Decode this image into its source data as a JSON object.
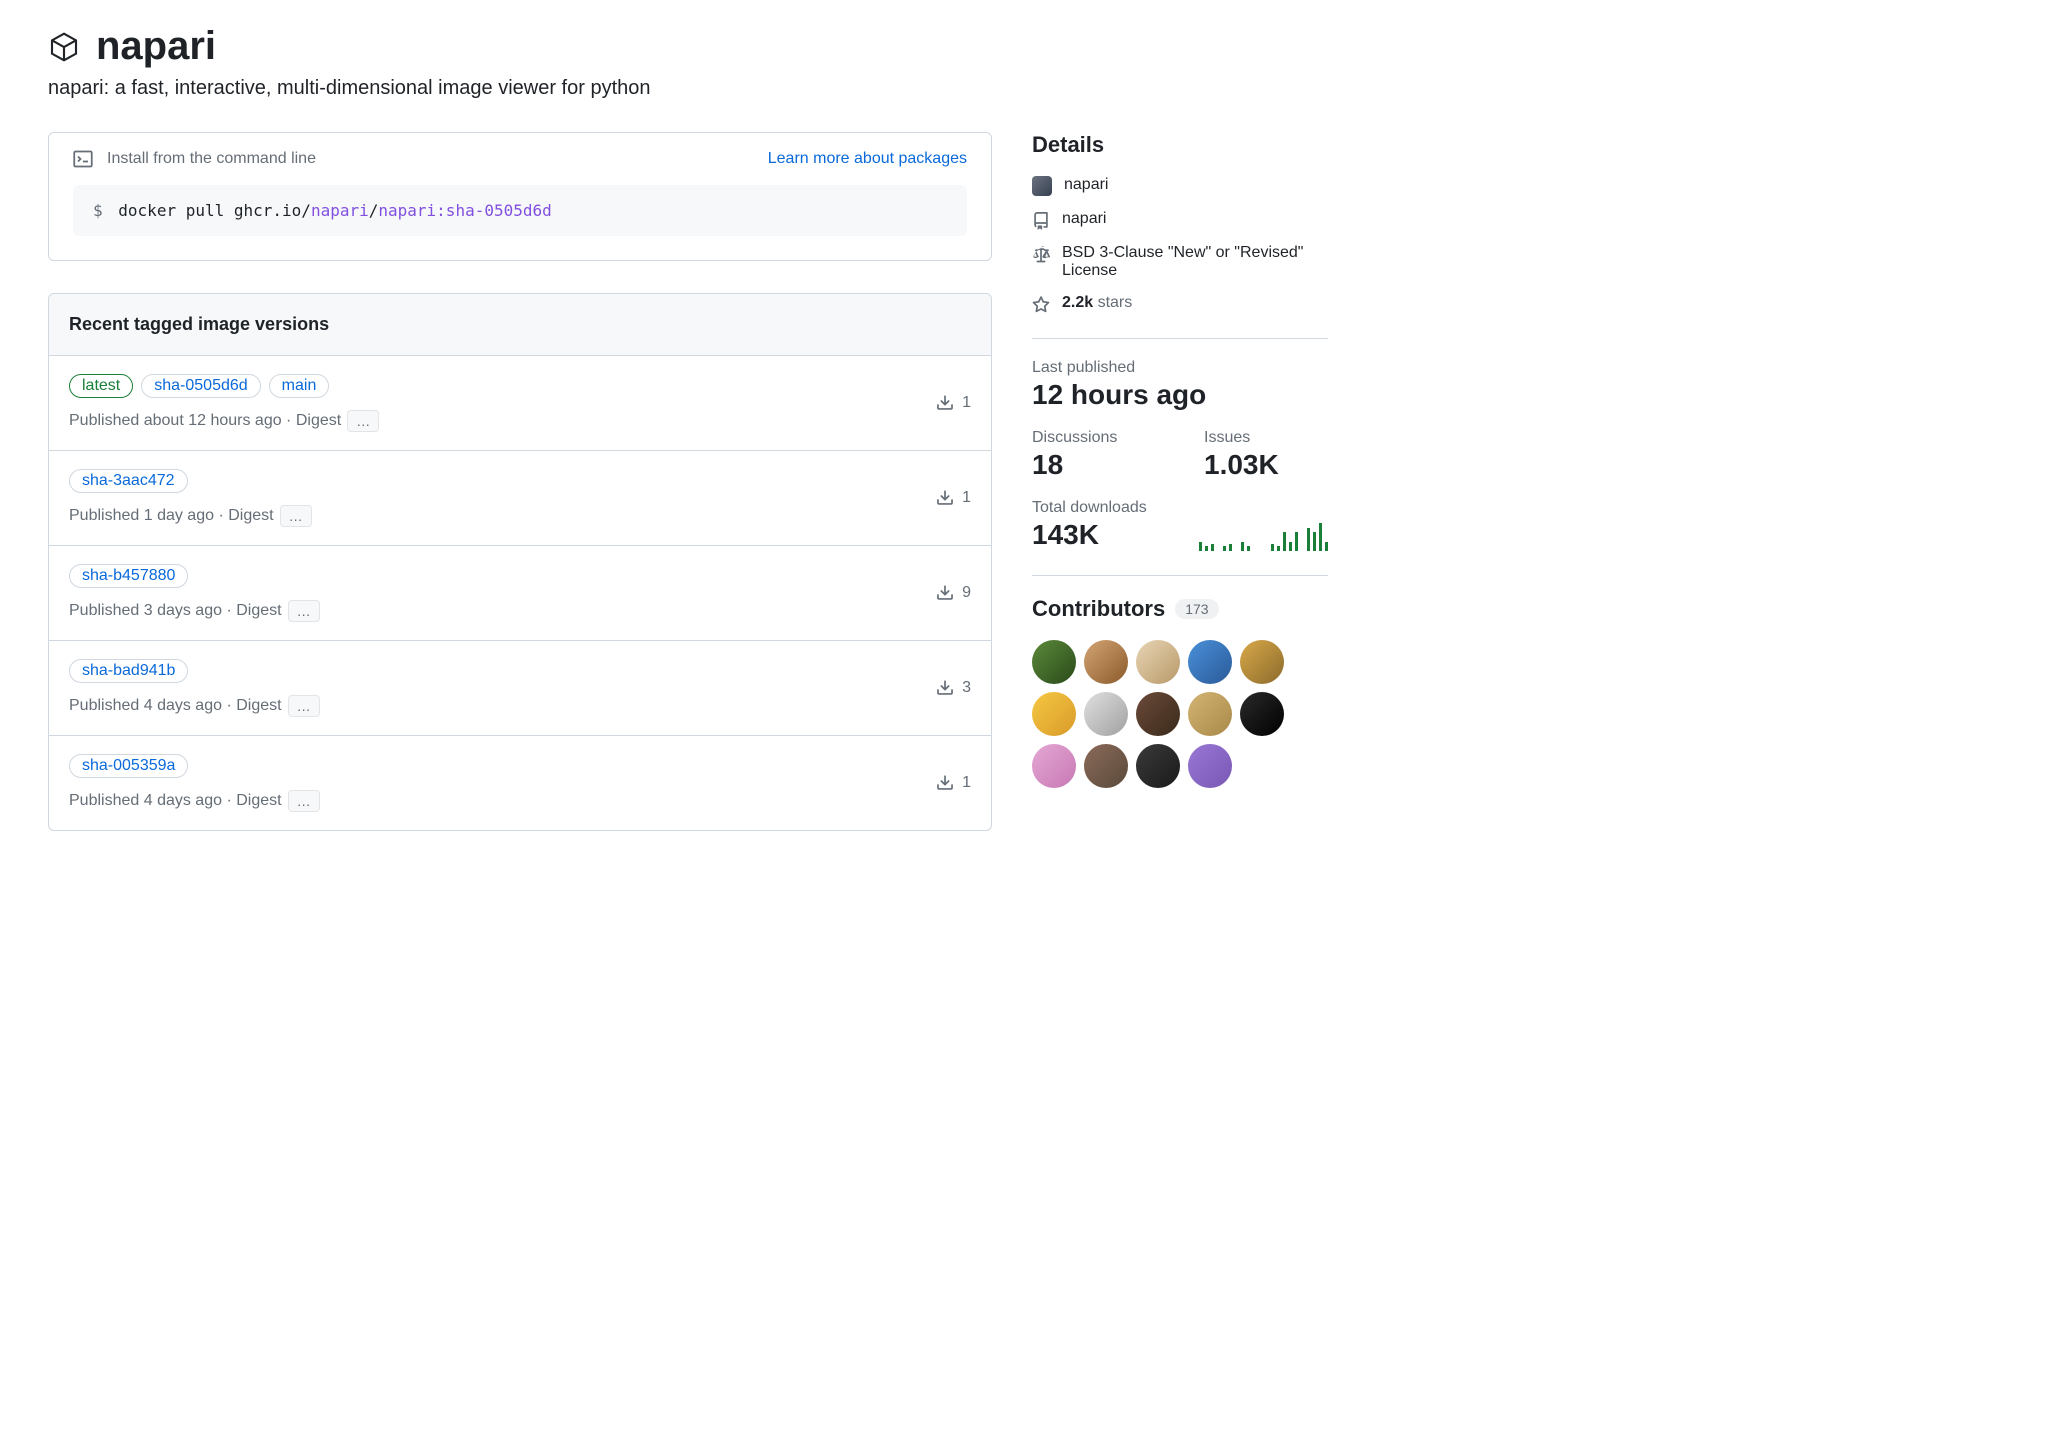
{
  "package": {
    "name": "napari",
    "description": "napari: a fast, interactive, multi-dimensional image viewer for python"
  },
  "install": {
    "label": "Install from the command line",
    "learn_link": "Learn more about packages",
    "prompt": "$",
    "cmd_prefix": "docker pull ghcr.io/",
    "cmd_org": "napari",
    "cmd_sep": "/",
    "cmd_ref": "napari:sha-0505d6d"
  },
  "versions": {
    "title": "Recent tagged image versions",
    "rows": [
      {
        "tags": [
          {
            "label": "latest",
            "variant": "latest"
          },
          {
            "label": "sha-0505d6d",
            "variant": ""
          },
          {
            "label": "main",
            "variant": ""
          }
        ],
        "meta": "Published about 12 hours ago · Digest",
        "downloads": "1"
      },
      {
        "tags": [
          {
            "label": "sha-3aac472",
            "variant": ""
          }
        ],
        "meta": "Published 1 day ago · Digest",
        "downloads": "1"
      },
      {
        "tags": [
          {
            "label": "sha-b457880",
            "variant": ""
          }
        ],
        "meta": "Published 3 days ago · Digest",
        "downloads": "9"
      },
      {
        "tags": [
          {
            "label": "sha-bad941b",
            "variant": ""
          }
        ],
        "meta": "Published 4 days ago · Digest",
        "downloads": "3"
      },
      {
        "tags": [
          {
            "label": "sha-005359a",
            "variant": ""
          }
        ],
        "meta": "Published 4 days ago · Digest",
        "downloads": "1"
      }
    ]
  },
  "details": {
    "title": "Details",
    "owner": "napari",
    "repo": "napari",
    "license": "BSD 3-Clause \"New\" or \"Revised\" License",
    "stars_count": "2.2k",
    "stars_suffix": " stars"
  },
  "stats": {
    "last_published_label": "Last published",
    "last_published_value": "12 hours ago",
    "discussions_label": "Discussions",
    "discussions_value": "18",
    "issues_label": "Issues",
    "issues_value": "1.03K",
    "downloads_label": "Total downloads",
    "downloads_value": "143K"
  },
  "sparkline": [
    4,
    2,
    3,
    0,
    2,
    3,
    0,
    4,
    2,
    0,
    0,
    0,
    3,
    2,
    8,
    4,
    8,
    0,
    10,
    8,
    12,
    4
  ],
  "contributors": {
    "title": "Contributors",
    "count": "173"
  }
}
